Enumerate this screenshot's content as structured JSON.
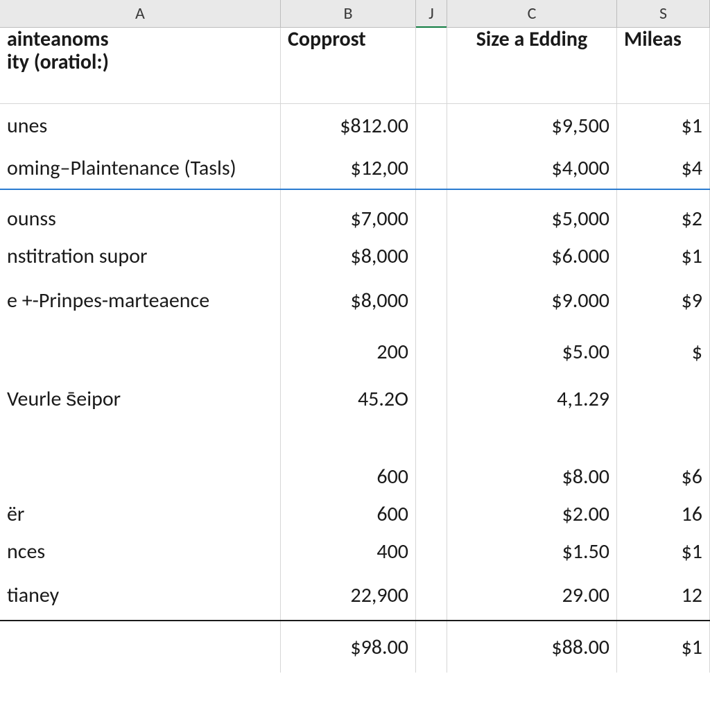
{
  "columns": {
    "A": "A",
    "B": "B",
    "J": "J",
    "C": "C",
    "S": "S"
  },
  "headers": {
    "A_line1": "ainteanoms",
    "A_line2": "ity (oratiol:)",
    "B": "Copprost",
    "C": "Size a Edding",
    "S": "Mileas"
  },
  "rows": [
    {
      "A": "unes",
      "B": "$812.00",
      "C": "$9,500",
      "S": "$1"
    },
    {
      "A": "oming–Plaintenance (Tasls)",
      "B": "$12,00",
      "C": "$4,000",
      "S": "$4"
    },
    {
      "A": "ounss",
      "B": "$7,000",
      "C": "$5,000",
      "S": "$2"
    },
    {
      "A": "nstitration supor",
      "B": "$8,000",
      "C": "$6.000",
      "S": "$1"
    },
    {
      "A": "e +-Prinpes-marteaence",
      "B": "$8,000",
      "C": "$9.000",
      "S": "$9"
    },
    {
      "A": "",
      "B": "200",
      "C": "$5.00",
      "S": "$"
    },
    {
      "A": "Veurle s̄eipor",
      "B": "45.2O",
      "C": "4,1.29",
      "S": ""
    },
    {
      "A": "",
      "B": "600",
      "C": "$8.00",
      "S": "$6"
    },
    {
      "A": "ër",
      "B": "600",
      "C": "$2.00",
      "S": "16"
    },
    {
      "A": "nces",
      "B": "400",
      "C": "$1.50",
      "S": "$1"
    },
    {
      "A": "tianey",
      "B": "22,900",
      "C": "29.00",
      "S": "12"
    },
    {
      "A": "",
      "B": "$98.00",
      "C": "$88.00",
      "S": "$1"
    }
  ]
}
